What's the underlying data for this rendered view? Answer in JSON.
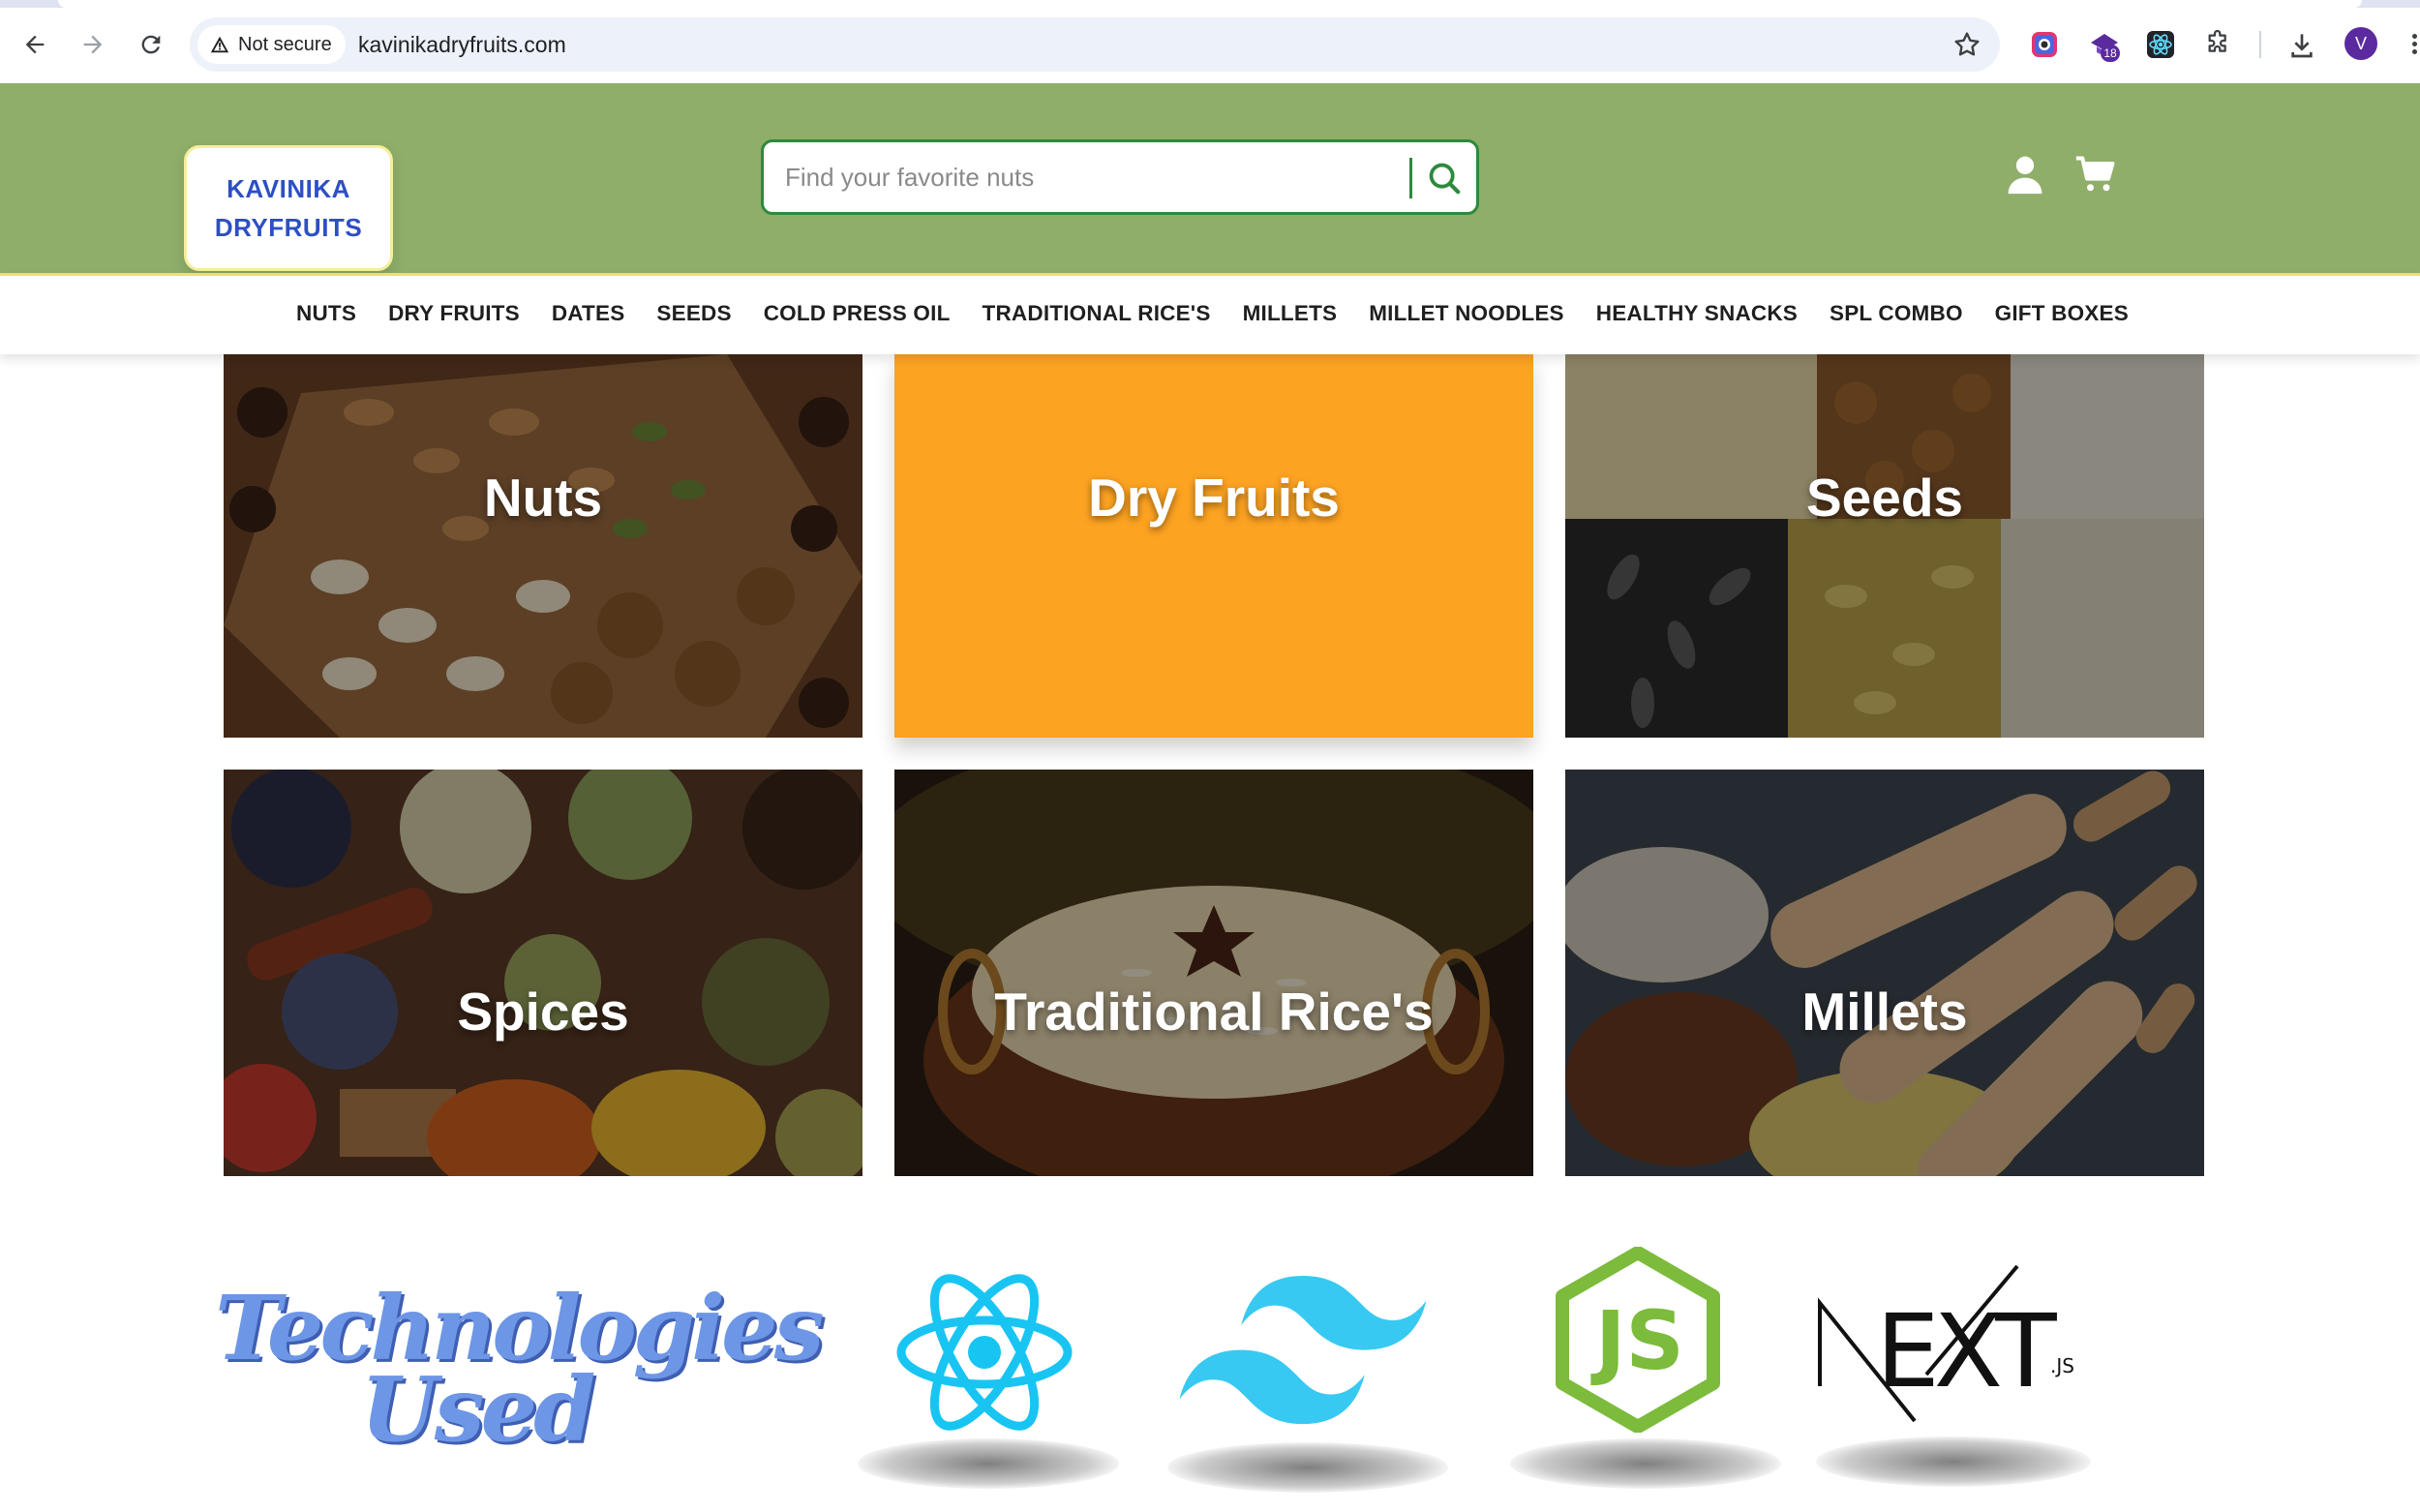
{
  "browser": {
    "security_label": "Not secure",
    "url": "kavinikadryfruits.com",
    "extension_badge": "18",
    "profile_initial": "V",
    "icons": [
      "back-arrow-icon",
      "forward-arrow-icon",
      "reload-icon",
      "warning-icon",
      "star-icon",
      "color-picker-extension-icon",
      "extension-18-icon",
      "react-devtools-icon",
      "puzzle-icon",
      "download-icon",
      "more-icon"
    ]
  },
  "header": {
    "logo_line1": "KAVINIKA",
    "logo_line2": "DRYFRUITS",
    "search_placeholder": "Find your favorite nuts",
    "search_value": "",
    "icons": [
      "search-icon",
      "user-icon",
      "cart-icon"
    ],
    "colors": {
      "header_bg": "#8fae69",
      "logo_text": "#2d4fc4",
      "search_accent": "#2c8a3c",
      "nav_underline": "#e9e36a"
    }
  },
  "nav": {
    "items": [
      "NUTS",
      "DRY FRUITS",
      "DATES",
      "SEEDS",
      "COLD PRESS OIL",
      "TRADITIONAL RICE'S",
      "MILLETS",
      "MILLET NOODLES",
      "HEALTHY SNACKS",
      "SPL COMBO",
      "GIFT BOXES"
    ]
  },
  "categories": [
    {
      "label": "Nuts"
    },
    {
      "label": "Dry Fruits",
      "color": "#fda322"
    },
    {
      "label": "Seeds"
    },
    {
      "label": "Spices"
    },
    {
      "label": "Traditional Rice's"
    },
    {
      "label": "Millets"
    }
  ],
  "technologies": {
    "title_line1": "Technologies",
    "title_line2": "Used",
    "logos": [
      "react-logo",
      "tailwind-logo",
      "nodejs-logo",
      "nextjs-logo"
    ],
    "next_suffix": ".JS",
    "colors": {
      "title": "#6d96e6",
      "react": "#18c5f2",
      "tailwind": "#38c9f2",
      "node": "#7cbb3b"
    }
  }
}
